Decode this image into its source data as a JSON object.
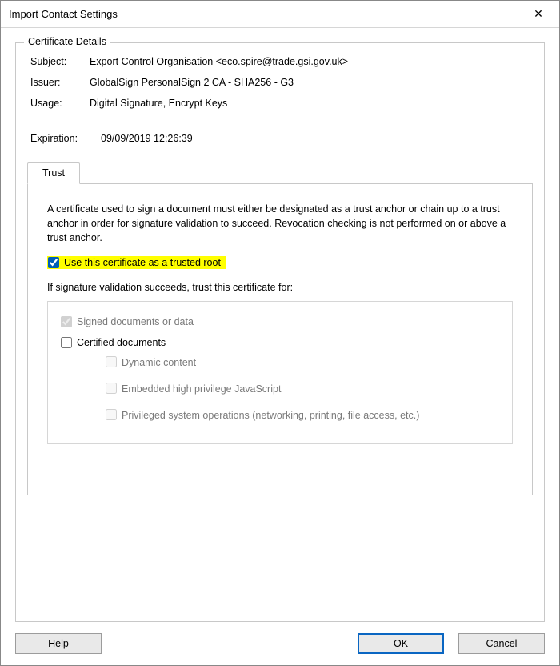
{
  "window": {
    "title": "Import Contact Settings"
  },
  "fieldset": {
    "legend": "Certificate Details",
    "subject_label": "Subject:",
    "subject_value": "Export Control Organisation <eco.spire@trade.gsi.gov.uk>",
    "issuer_label": "Issuer:",
    "issuer_value": "GlobalSign PersonalSign 2 CA - SHA256 - G3",
    "usage_label": "Usage:",
    "usage_value": "Digital Signature, Encrypt Keys",
    "exp_label": "Expiration:",
    "exp_value": "09/09/2019 12:26:39"
  },
  "tabs": {
    "trust": {
      "label": "Trust",
      "info": "A certificate used to sign a document must either be designated as a trust anchor or chain up to a trust anchor in order for signature validation to succeed.  Revocation checking is not performed on or above a trust anchor.",
      "trusted_root": "Use this certificate as a trusted root",
      "sublabel": "If signature validation succeeds, trust this certificate for:",
      "opts": {
        "signed": "Signed documents or data",
        "certified": "Certified documents",
        "dynamic": "Dynamic content",
        "js": "Embedded high privilege JavaScript",
        "privops": "Privileged system operations (networking, printing, file access, etc.)"
      }
    }
  },
  "buttons": {
    "help": "Help",
    "ok": "OK",
    "cancel": "Cancel"
  }
}
